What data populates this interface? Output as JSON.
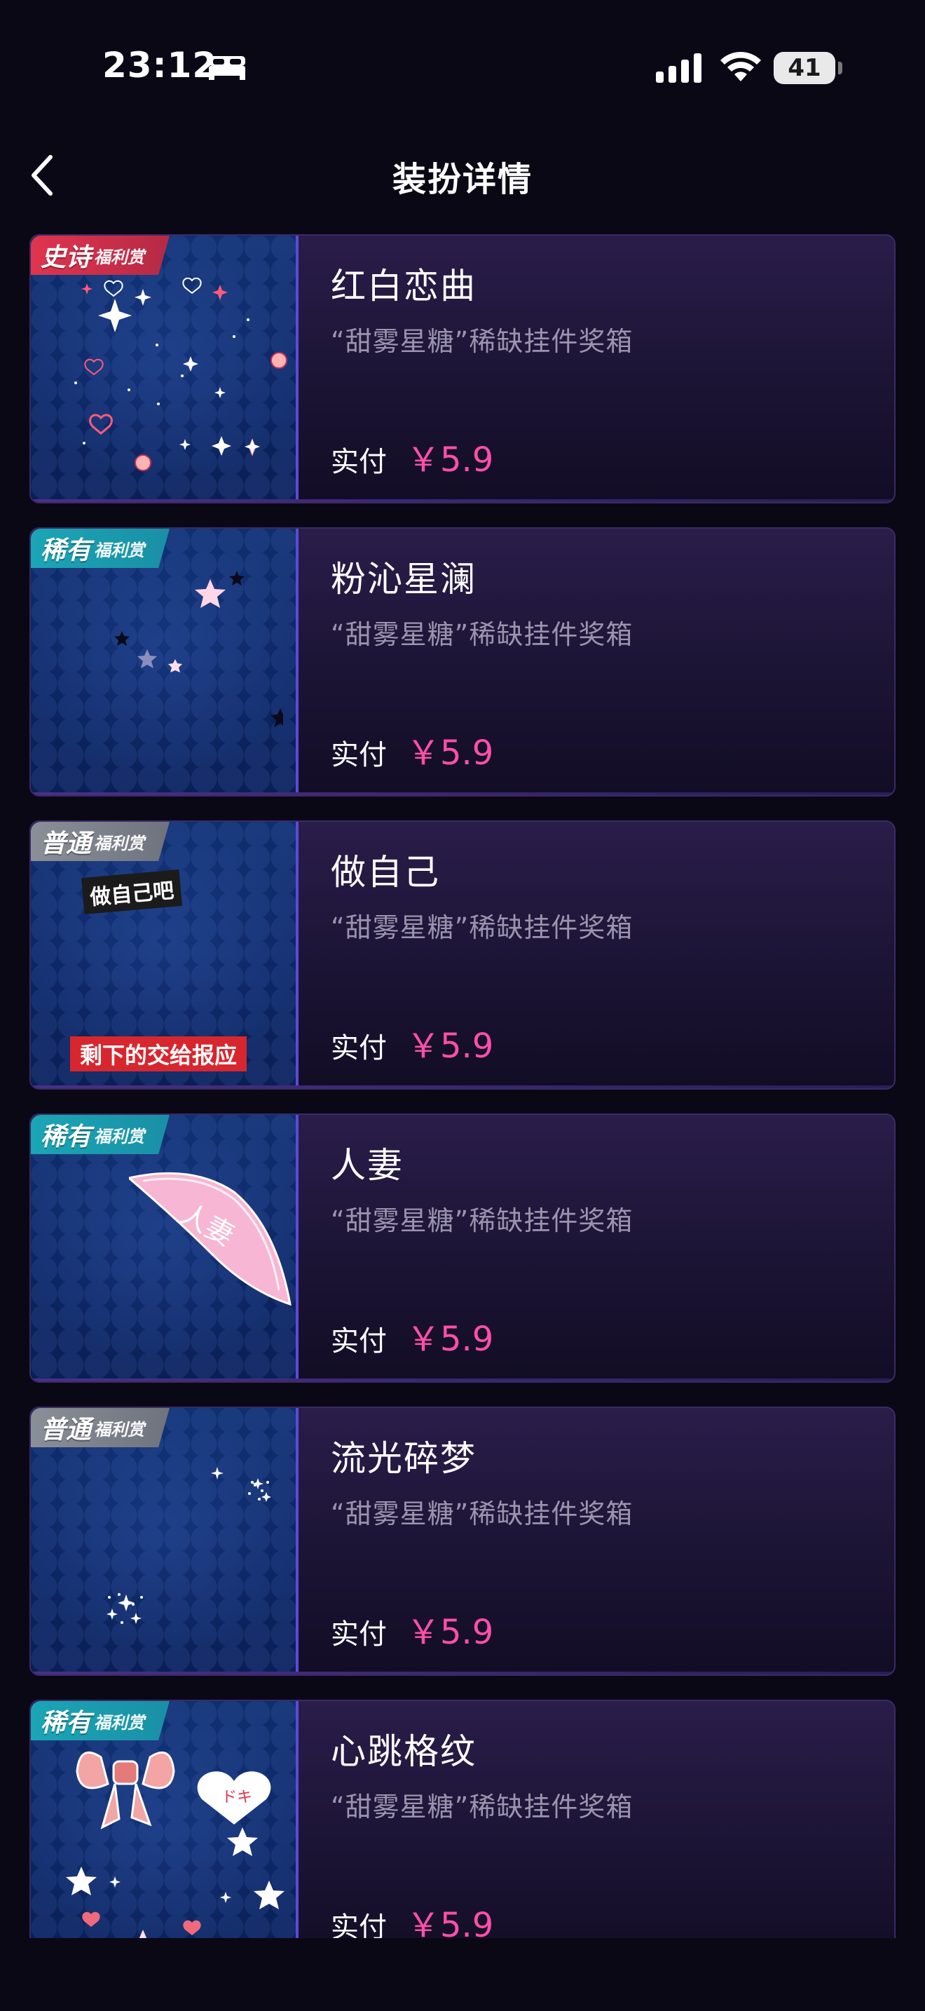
{
  "status_bar": {
    "time": "23:12",
    "battery_level": "41",
    "icons": [
      "bed-icon",
      "signal-icon",
      "wifi-icon",
      "battery-icon"
    ]
  },
  "header": {
    "title": "装扮详情",
    "back_icon": "chevron-left-icon"
  },
  "items": [
    {
      "badge_main": "史诗",
      "badge_sub": "福利赏",
      "badge_type": "epic",
      "name": "红白恋曲",
      "source": "“甜雾星糖”稀缺挂件奖箱",
      "price_label": "实付",
      "price": "￥5.9"
    },
    {
      "badge_main": "稀有",
      "badge_sub": "福利赏",
      "badge_type": "rare",
      "name": "粉沁星澜",
      "source": "“甜雾星糖”稀缺挂件奖箱",
      "price_label": "实付",
      "price": "￥5.9"
    },
    {
      "badge_main": "普通",
      "badge_sub": "福利赏",
      "badge_type": "common",
      "name": "做自己",
      "source": "“甜雾星糖”稀缺挂件奖箱",
      "price_label": "实付",
      "price": "￥5.9",
      "thumb_text_top": "做自己吧",
      "thumb_text_bottom": "剩下的交给报应"
    },
    {
      "badge_main": "稀有",
      "badge_sub": "福利赏",
      "badge_type": "rare",
      "name": "人妻",
      "source": "“甜雾星糖”稀缺挂件奖箱",
      "price_label": "实付",
      "price": "￥5.9",
      "thumb_text": "人妻"
    },
    {
      "badge_main": "普通",
      "badge_sub": "福利赏",
      "badge_type": "common",
      "name": "流光碎梦",
      "source": "“甜雾星糖”稀缺挂件奖箱",
      "price_label": "实付",
      "price": "￥5.9"
    },
    {
      "badge_main": "稀有",
      "badge_sub": "福利赏",
      "badge_type": "rare",
      "name": "心跳格纹",
      "source": "“甜雾星糖”稀缺挂件奖箱",
      "price_label": "实付",
      "price": "￥5.9",
      "thumb_text": "ドキ"
    }
  ],
  "colors": {
    "background": "#0b0816",
    "price": "#ff4fa8",
    "muted_text": "#9a94ad",
    "epic_badge": "#e0344f",
    "rare_badge": "#1aa6b6",
    "common_badge": "#8a8f98"
  }
}
